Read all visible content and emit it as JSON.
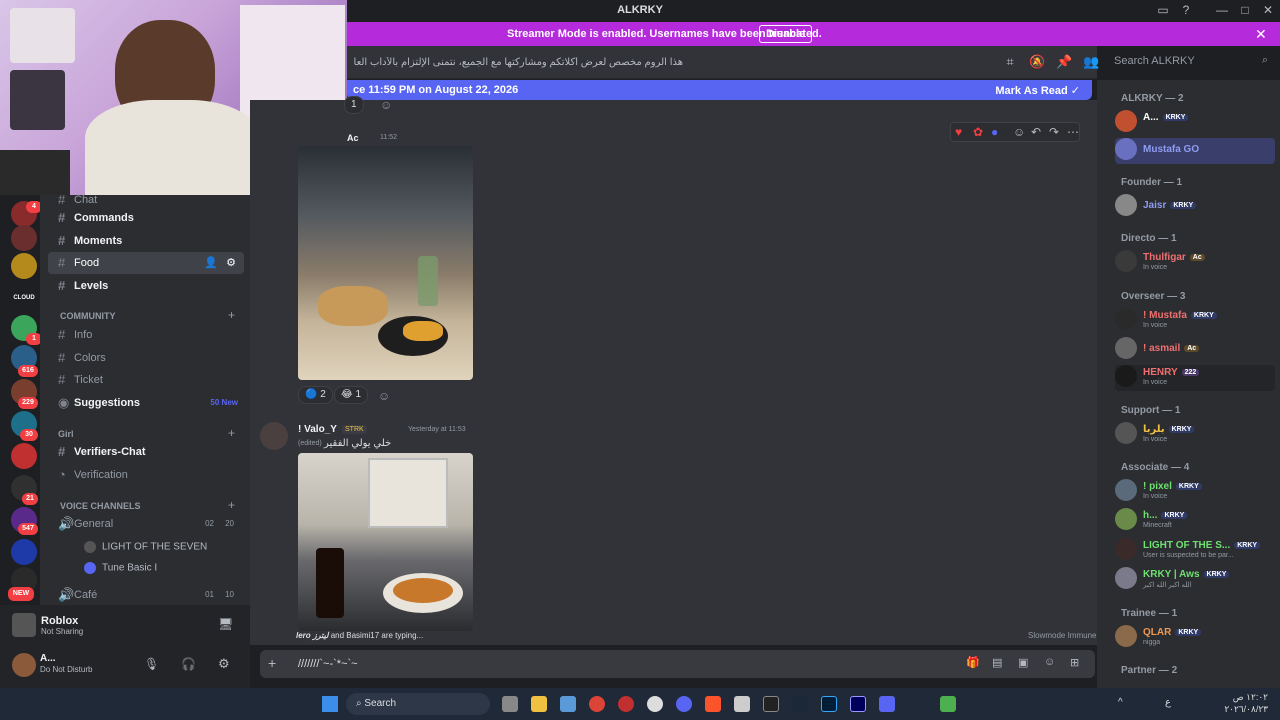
{
  "window": {
    "title": "ALKRKY"
  },
  "streamer_bar": {
    "message": "Streamer Mode is enabled. Usernames have been truncated.",
    "disable_label": "Disable"
  },
  "header": {
    "topic": "هذا الروم مخصص لعرض أكلاتكم ومشاركتها مع الجميع، نتمنى الإلتزام بالآداب العامة والحفاظ على جودة المحتوى.",
    "search_placeholder": "Search ALKRKY"
  },
  "new_messages_bar": {
    "text": "ce 11:59 PM on August 22, 2026",
    "mark_read": "Mark As Read"
  },
  "channels": {
    "items": [
      {
        "label": "Chat"
      },
      {
        "label": "Commands"
      },
      {
        "label": "Moments"
      },
      {
        "label": "Food"
      },
      {
        "label": "Levels"
      }
    ],
    "category_community": "COMMUNITY",
    "community_items": [
      {
        "label": "Info"
      },
      {
        "label": "Colors"
      },
      {
        "label": "Ticket"
      },
      {
        "label": "Suggestions",
        "badge": "50 New"
      }
    ],
    "category_girl": "Girl",
    "girl_items": [
      {
        "label": "Verifiers-Chat"
      },
      {
        "label": "Verification"
      }
    ],
    "category_voice": "VOICE CHANNELS",
    "voice_general": {
      "label": "General",
      "count_a": "02",
      "count_b": "20"
    },
    "voice_users": [
      {
        "name": "LIGHT OF THE SEVEN"
      },
      {
        "name": "Tune Basic I"
      }
    ],
    "voice_cafe": {
      "label": "Café",
      "count_a": "01",
      "count_b": "10"
    }
  },
  "server_badges": [
    "4",
    "1",
    "616",
    "229",
    "30",
    "21",
    "547",
    "NEW"
  ],
  "activity": {
    "game": "Roblox",
    "status": "Not Sharing"
  },
  "user": {
    "name": "A...",
    "status": "Do Not Disturb"
  },
  "messages": [
    {
      "author": "Ac",
      "time": "11:52",
      "reactions": [
        {
          "emoji": "🔵",
          "count": "2"
        },
        {
          "emoji": "😂",
          "count": "1"
        }
      ]
    },
    {
      "author": "! Valo_Y",
      "tag": "STRK",
      "time": "Yesterday at 11:53",
      "edited": "(edited)",
      "text": "خلي يولي الفقير"
    }
  ],
  "top_reaction": {
    "count": "1"
  },
  "typing": {
    "text": "and Basimi17 are typing...",
    "first": "lero ليترز"
  },
  "slowmode": "Slowmode Immune",
  "composer": {
    "value": "///////`~-`*~`~"
  },
  "members": {
    "groups": [
      {
        "name": "ALKRKY — 2",
        "members": [
          {
            "name": "A...",
            "tag": "KRKY",
            "color": "#ffffff"
          },
          {
            "name": "Mustafa GO",
            "color": "#8e9cf0"
          }
        ]
      },
      {
        "name": "Founder — 1",
        "members": [
          {
            "name": "Jaisr",
            "tag": "KRKY",
            "color": "#8e9cf0"
          }
        ]
      },
      {
        "name": "Directo — 1",
        "members": [
          {
            "name": "Thulfigar",
            "tag": "Ac",
            "status": "In voice",
            "color": "#f06f6f"
          }
        ]
      },
      {
        "name": "Overseer — 3",
        "members": [
          {
            "name": "! Mustafa",
            "tag": "KRKY",
            "status": "In voice",
            "color": "#f06f6f"
          },
          {
            "name": "! asmail",
            "tag": "Ac",
            "color": "#f06f6f"
          },
          {
            "name": "HENRY",
            "tag": "222",
            "status": "In voice",
            "color": "#f06f6f"
          }
        ]
      },
      {
        "name": "Support — 1",
        "members": [
          {
            "name": "بلربا",
            "tag": "KRKY",
            "status": "In voice",
            "color": "#f0c040"
          }
        ]
      },
      {
        "name": "Associate — 4",
        "members": [
          {
            "name": "! pixel",
            "tag": "KRKY",
            "status": "In voice",
            "color": "#6fe070"
          },
          {
            "name": "h...",
            "tag": "KRKY",
            "status": "Minecraft",
            "color": "#6fe070"
          },
          {
            "name": "LIGHT OF THE S...",
            "tag": "KRKY",
            "status": "User is suspected to be par...",
            "color": "#6fe070"
          },
          {
            "name": "KRKY | Aws",
            "tag": "KRKY",
            "status": "الله اكبر الله اكبر",
            "color": "#6fe070"
          }
        ]
      },
      {
        "name": "Trainee — 1",
        "members": [
          {
            "name": "QLAR",
            "tag": "KRKY",
            "status": "nigga",
            "color": "#f09850"
          }
        ]
      },
      {
        "name": "Partner — 2",
        "members": []
      }
    ]
  },
  "taskbar": {
    "search": "Search",
    "time": "١٢:٠٢ ص",
    "date": "٢٠٢٦/٠٨/٢٣",
    "lang": "ع"
  }
}
